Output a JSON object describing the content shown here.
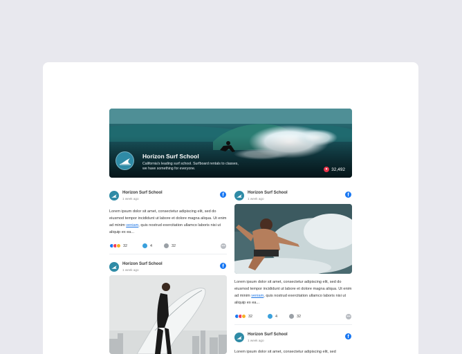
{
  "header": {
    "name": "Horizon Surf School",
    "description": "California's leading surf school. Surfboard rentals to classes, we have something for everyone.",
    "likes": "32,492"
  },
  "posts": [
    {
      "author": "Horizon Surf School",
      "time": "1 week ago",
      "text_before": "Lorem ipsum dolor sit amet, consectetur adipiscing elit, sed do eiusmod tempor incididunt ut labore et dolore magna aliqua. Ut enim ad minim ",
      "link": "veniam",
      "text_after": ", quis nostrud exercitation ullamco laboris nisi ut aliquip ex ea...",
      "reactions": "32",
      "comments": "4",
      "shares": "32"
    },
    {
      "author": "Horizon Surf School",
      "time": "1 week ago",
      "text_before": "Lorem ipsum dolor sit amet, consectetur adipiscing elit, sed do eiusmod tempor incididunt ut labore et dolore magna aliqua. Ut enim ad minim ",
      "link": "veniam",
      "text_after": ", quis nostrud exercitation ullamco laboris nisi ut aliquip ex ea...",
      "reactions": "32",
      "comments": "4",
      "shares": "32"
    },
    {
      "author": "Horizon Surf School",
      "time": "1 week ago"
    },
    {
      "author": "Horizon Surf School",
      "time": "1 week ago",
      "text_partial": "Lorem ipsum dolor sit amet, consectetur adipiscing elit, sed"
    }
  ],
  "colors": {
    "page_bg": "#e8e8ee",
    "facebook_blue": "#1877f2",
    "avatar_teal": "#2f8ba6",
    "link": "#1b74e4"
  },
  "icons": [
    "surf-logo-icon",
    "heart-icon",
    "facebook-icon",
    "like-reaction-icon",
    "love-reaction-icon",
    "wow-reaction-icon",
    "comment-icon",
    "share-icon",
    "more-icon"
  ]
}
